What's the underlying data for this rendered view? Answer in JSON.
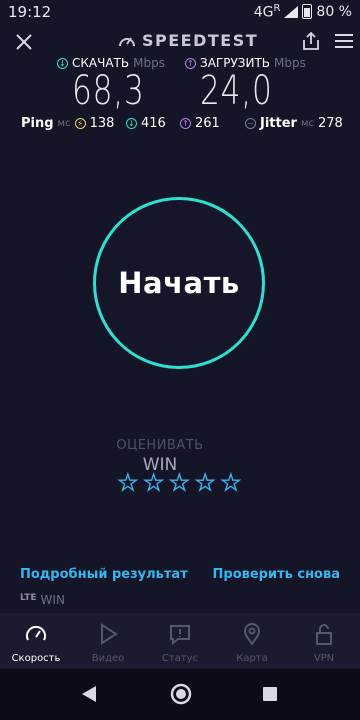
{
  "status_bar": {
    "time": "19:12",
    "network": "4G",
    "network_sup": "R",
    "battery": "80 %"
  },
  "app": {
    "brand": "SPEEDTEST"
  },
  "download": {
    "label": "СКАЧАТЬ",
    "unit": "Mbps",
    "value": "68,3"
  },
  "upload": {
    "label": "ЗАГРУЗИТЬ",
    "unit": "Mbps",
    "value": "24,0"
  },
  "ping": {
    "label": "Ping",
    "unit": "мс",
    "idle": "138",
    "download": "416",
    "upload": "261"
  },
  "jitter": {
    "label": "Jitter",
    "unit": "мс",
    "value": "278"
  },
  "start_button": {
    "label": "Начать"
  },
  "rating": {
    "title": "ОЦЕНИВАТЬ",
    "provider": "WIN",
    "stars": 5
  },
  "links": {
    "details": "Подробный результат",
    "test_again": "Проверить снова"
  },
  "connection": {
    "type": "LTE",
    "provider": "WIN"
  },
  "nav": [
    {
      "label": "Скорость",
      "icon": "speedometer-icon",
      "active": true
    },
    {
      "label": "Видео",
      "icon": "play-icon",
      "active": false
    },
    {
      "label": "Статус",
      "icon": "alert-icon",
      "active": false
    },
    {
      "label": "Карта",
      "icon": "map-pin-icon",
      "active": false
    },
    {
      "label": "VPN",
      "icon": "lock-icon",
      "active": false
    }
  ],
  "colors": {
    "background": "#141526",
    "accent_teal": "#2ee0cf",
    "link_blue": "#33b8f3",
    "upload_purple": "#b37cf4",
    "ping_yellow": "#f0d35a"
  }
}
